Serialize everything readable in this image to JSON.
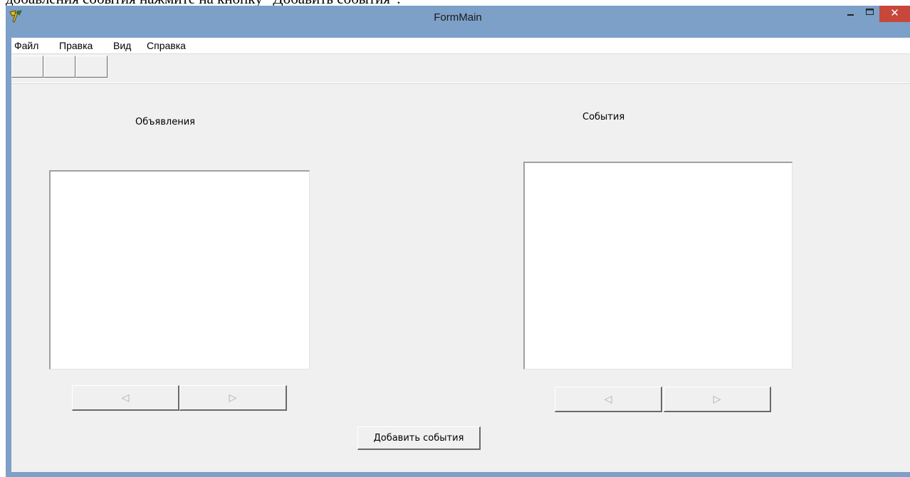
{
  "document": {
    "caption_fragment": "добавления события нажмите на кнопку “Добавить события”."
  },
  "window": {
    "title": "FormMain",
    "close_glyph": "✕",
    "minimize_glyph": "–",
    "maximize_glyph": "☐"
  },
  "menu": {
    "items": [
      "Файл",
      "Правка",
      "Вид",
      "Справка"
    ]
  },
  "toolbar": {
    "button_count": 3
  },
  "ads_panel": {
    "label": "Объявления",
    "prev_glyph": "◁",
    "next_glyph": "▷"
  },
  "events_panel": {
    "label": "События",
    "prev_glyph": "◁",
    "next_glyph": "▷"
  },
  "actions": {
    "add_events_label": "Добавить события"
  },
  "colors": {
    "titlebar": "#7ca0c8",
    "close_button": "#c7473a",
    "client_bg": "#f0f0f0"
  }
}
